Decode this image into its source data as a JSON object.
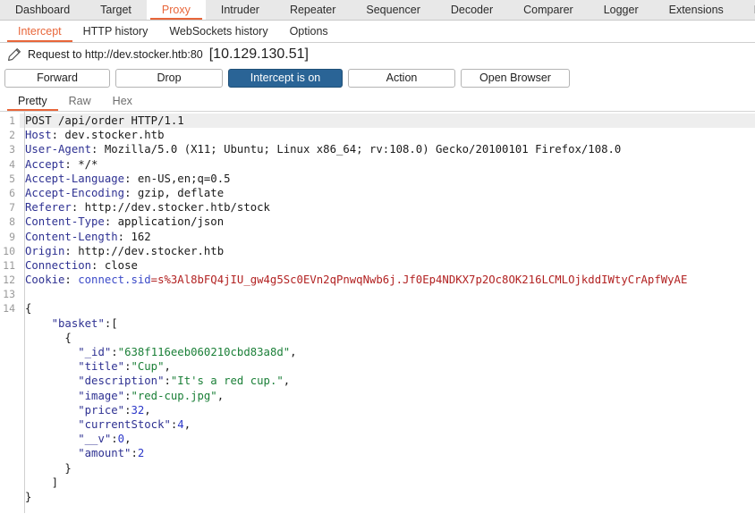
{
  "main_tabs": [
    {
      "label": "Dashboard",
      "active": false
    },
    {
      "label": "Target",
      "active": false
    },
    {
      "label": "Proxy",
      "active": true
    },
    {
      "label": "Intruder",
      "active": false
    },
    {
      "label": "Repeater",
      "active": false
    },
    {
      "label": "Sequencer",
      "active": false
    },
    {
      "label": "Decoder",
      "active": false
    },
    {
      "label": "Comparer",
      "active": false
    },
    {
      "label": "Logger",
      "active": false
    },
    {
      "label": "Extensions",
      "active": false
    },
    {
      "label": "Le",
      "active": false
    }
  ],
  "sub_tabs": [
    {
      "label": "Intercept",
      "active": true
    },
    {
      "label": "HTTP history",
      "active": false
    },
    {
      "label": "WebSockets history",
      "active": false
    },
    {
      "label": "Options",
      "active": false
    }
  ],
  "request_info": {
    "icon": "pencil-icon",
    "text": "Request to http://dev.stocker.htb:80",
    "ip": "[10.129.130.51]"
  },
  "buttons": {
    "forward": "Forward",
    "drop": "Drop",
    "intercept": "Intercept is on",
    "action": "Action",
    "open_browser": "Open Browser"
  },
  "editor_tabs": [
    {
      "label": "Pretty",
      "active": true
    },
    {
      "label": "Raw",
      "active": false
    },
    {
      "label": "Hex",
      "active": false
    }
  ],
  "colors": {
    "accent_orange": "#e8663a",
    "button_blue": "#2a6496",
    "header_name": "#2e3192",
    "json_string": "#1a7f37",
    "json_number": "#2b37c8",
    "cookie_value": "#b22222"
  },
  "request": {
    "lines": [
      {
        "n": "1",
        "highlight": true,
        "segs": [
          {
            "t": "POST /api/order HTTP/1.1",
            "c": "k-val"
          }
        ]
      },
      {
        "n": "2",
        "segs": [
          {
            "t": "Host",
            "c": "k-hdr"
          },
          {
            "t": ": dev.stocker.htb",
            "c": "k-val"
          }
        ]
      },
      {
        "n": "3",
        "segs": [
          {
            "t": "User-Agent",
            "c": "k-hdr"
          },
          {
            "t": ": Mozilla/5.0 (X11; Ubuntu; Linux x86_64; rv:108.0) Gecko/20100101 Firefox/108.0",
            "c": "k-val"
          }
        ]
      },
      {
        "n": "4",
        "segs": [
          {
            "t": "Accept",
            "c": "k-hdr"
          },
          {
            "t": ": */*",
            "c": "k-val"
          }
        ]
      },
      {
        "n": "5",
        "segs": [
          {
            "t": "Accept-Language",
            "c": "k-hdr"
          },
          {
            "t": ": en-US,en;q=0.5",
            "c": "k-val"
          }
        ]
      },
      {
        "n": "6",
        "segs": [
          {
            "t": "Accept-Encoding",
            "c": "k-hdr"
          },
          {
            "t": ": gzip, deflate",
            "c": "k-val"
          }
        ]
      },
      {
        "n": "7",
        "segs": [
          {
            "t": "Referer",
            "c": "k-hdr"
          },
          {
            "t": ": http://dev.stocker.htb/stock",
            "c": "k-val"
          }
        ]
      },
      {
        "n": "8",
        "segs": [
          {
            "t": "Content-Type",
            "c": "k-hdr"
          },
          {
            "t": ": application/json",
            "c": "k-val"
          }
        ]
      },
      {
        "n": "9",
        "segs": [
          {
            "t": "Content-Length",
            "c": "k-hdr"
          },
          {
            "t": ": 162",
            "c": "k-val"
          }
        ]
      },
      {
        "n": "10",
        "segs": [
          {
            "t": "Origin",
            "c": "k-hdr"
          },
          {
            "t": ": http://dev.stocker.htb",
            "c": "k-val"
          }
        ]
      },
      {
        "n": "11",
        "segs": [
          {
            "t": "Connection",
            "c": "k-hdr"
          },
          {
            "t": ": close",
            "c": "k-val"
          }
        ]
      },
      {
        "n": "12",
        "segs": [
          {
            "t": "Cookie",
            "c": "k-hdr"
          },
          {
            "t": ": ",
            "c": "k-val"
          },
          {
            "t": "connect.sid",
            "c": "k-ck"
          },
          {
            "t": "=",
            "c": "k-ckv"
          },
          {
            "t": "s%3Al8bFQ4jIU_gw4g5Sc0EVn2qPnwqNwb6j.Jf0Ep4NDKX7p2Oc8OK216LCMLOjkddIWtyCrApfWyAE",
            "c": "k-ckv"
          }
        ]
      },
      {
        "n": "13",
        "segs": [
          {
            "t": "",
            "c": "k-val"
          }
        ]
      },
      {
        "n": "14",
        "segs": [
          {
            "t": "{",
            "c": "k-punc"
          }
        ]
      },
      {
        "n": "",
        "segs": [
          {
            "t": "    ",
            "c": "k-punc"
          },
          {
            "t": "\"basket\"",
            "c": "k-hdr"
          },
          {
            "t": ":[",
            "c": "k-punc"
          }
        ]
      },
      {
        "n": "",
        "segs": [
          {
            "t": "      {",
            "c": "k-punc"
          }
        ]
      },
      {
        "n": "",
        "segs": [
          {
            "t": "        ",
            "c": "k-punc"
          },
          {
            "t": "\"_id\"",
            "c": "k-hdr"
          },
          {
            "t": ":",
            "c": "k-punc"
          },
          {
            "t": "\"638f116eeb060210cbd83a8d\"",
            "c": "k-str"
          },
          {
            "t": ",",
            "c": "k-punc"
          }
        ]
      },
      {
        "n": "",
        "segs": [
          {
            "t": "        ",
            "c": "k-punc"
          },
          {
            "t": "\"title\"",
            "c": "k-hdr"
          },
          {
            "t": ":",
            "c": "k-punc"
          },
          {
            "t": "\"Cup\"",
            "c": "k-str"
          },
          {
            "t": ",",
            "c": "k-punc"
          }
        ]
      },
      {
        "n": "",
        "segs": [
          {
            "t": "        ",
            "c": "k-punc"
          },
          {
            "t": "\"description\"",
            "c": "k-hdr"
          },
          {
            "t": ":",
            "c": "k-punc"
          },
          {
            "t": "\"It's a red cup.\"",
            "c": "k-str"
          },
          {
            "t": ",",
            "c": "k-punc"
          }
        ]
      },
      {
        "n": "",
        "segs": [
          {
            "t": "        ",
            "c": "k-punc"
          },
          {
            "t": "\"image\"",
            "c": "k-hdr"
          },
          {
            "t": ":",
            "c": "k-punc"
          },
          {
            "t": "\"red-cup.jpg\"",
            "c": "k-str"
          },
          {
            "t": ",",
            "c": "k-punc"
          }
        ]
      },
      {
        "n": "",
        "segs": [
          {
            "t": "        ",
            "c": "k-punc"
          },
          {
            "t": "\"price\"",
            "c": "k-hdr"
          },
          {
            "t": ":",
            "c": "k-punc"
          },
          {
            "t": "32",
            "c": "k-num"
          },
          {
            "t": ",",
            "c": "k-punc"
          }
        ]
      },
      {
        "n": "",
        "segs": [
          {
            "t": "        ",
            "c": "k-punc"
          },
          {
            "t": "\"currentStock\"",
            "c": "k-hdr"
          },
          {
            "t": ":",
            "c": "k-punc"
          },
          {
            "t": "4",
            "c": "k-num"
          },
          {
            "t": ",",
            "c": "k-punc"
          }
        ]
      },
      {
        "n": "",
        "segs": [
          {
            "t": "        ",
            "c": "k-punc"
          },
          {
            "t": "\"__v\"",
            "c": "k-hdr"
          },
          {
            "t": ":",
            "c": "k-punc"
          },
          {
            "t": "0",
            "c": "k-num"
          },
          {
            "t": ",",
            "c": "k-punc"
          }
        ]
      },
      {
        "n": "",
        "segs": [
          {
            "t": "        ",
            "c": "k-punc"
          },
          {
            "t": "\"amount\"",
            "c": "k-hdr"
          },
          {
            "t": ":",
            "c": "k-punc"
          },
          {
            "t": "2",
            "c": "k-num"
          }
        ]
      },
      {
        "n": "",
        "segs": [
          {
            "t": "      }",
            "c": "k-punc"
          }
        ]
      },
      {
        "n": "",
        "segs": [
          {
            "t": "    ]",
            "c": "k-punc"
          }
        ]
      },
      {
        "n": "",
        "segs": [
          {
            "t": "}",
            "c": "k-punc"
          }
        ]
      }
    ]
  }
}
